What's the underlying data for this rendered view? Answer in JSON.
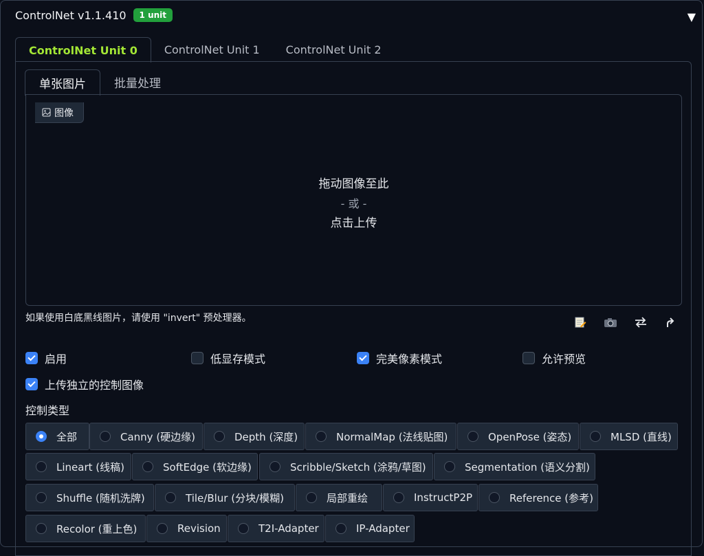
{
  "header": {
    "title": "ControlNet v1.1.410",
    "badge": "1 unit",
    "collapse_glyph": "▼"
  },
  "unit_tabs": [
    "ControlNet Unit 0",
    "ControlNet Unit 1",
    "ControlNet Unit 2"
  ],
  "image_tabs": [
    "单张图片",
    "批量处理"
  ],
  "dropzone": {
    "label": "图像",
    "main": "拖动图像至此",
    "or": "- 或 -",
    "click": "点击上传"
  },
  "hint": "如果使用白底黑线图片，请使用 \"invert\" 预处理器。",
  "tool_icons": [
    "edit-icon",
    "camera-icon",
    "swap-icon",
    "send-dimensions-icon"
  ],
  "checkboxes": {
    "enable": {
      "label": "启用",
      "checked": true
    },
    "low_vram": {
      "label": "低显存模式",
      "checked": false
    },
    "pixel_perfect": {
      "label": "完美像素模式",
      "checked": true
    },
    "allow_preview": {
      "label": "允许预览",
      "checked": false
    },
    "upload_independent": {
      "label": "上传独立的控制图像",
      "checked": true
    }
  },
  "control_type": {
    "label": "控制类型",
    "selected": "全部",
    "options": [
      "全部",
      "Canny (硬边缘)",
      "Depth (深度)",
      "NormalMap (法线贴图)",
      "OpenPose (姿态)",
      "MLSD (直线)",
      "Lineart (线稿)",
      "SoftEdge (软边缘)",
      "Scribble/Sketch (涂鸦/草图)",
      "Segmentation (语义分割)",
      "Shuffle (随机洗牌)",
      "Tile/Blur (分块/模糊)",
      "局部重绘",
      "InstructP2P",
      "Reference (参考)",
      "Recolor (重上色)",
      "Revision",
      "T2I-Adapter",
      "IP-Adapter"
    ]
  }
}
